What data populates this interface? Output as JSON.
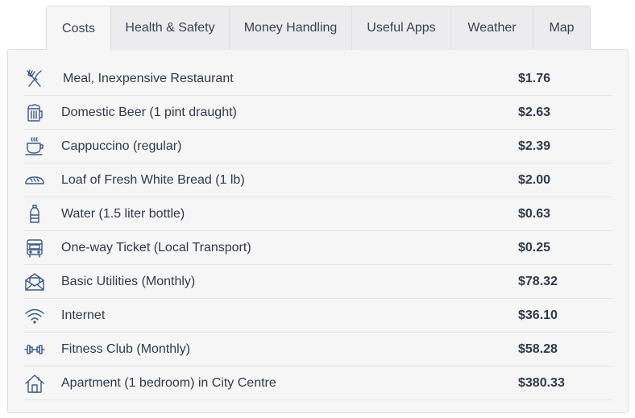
{
  "tabs": [
    {
      "label": "Costs",
      "active": true
    },
    {
      "label": "Health & Safety"
    },
    {
      "label": "Money Handling"
    },
    {
      "label": "Useful Apps"
    },
    {
      "label": "Weather"
    },
    {
      "label": "Map"
    }
  ],
  "costs": [
    {
      "icon": "fork-knife-icon",
      "label": "Meal, Inexpensive Restaurant",
      "value": "$1.76"
    },
    {
      "icon": "beer-mug-icon",
      "label": "Domestic Beer (1 pint draught)",
      "value": "$2.63"
    },
    {
      "icon": "coffee-cup-icon",
      "label": "Cappuccino (regular)",
      "value": "$2.39"
    },
    {
      "icon": "bread-icon",
      "label": "Loaf of Fresh White Bread (1 lb)",
      "value": "$2.00"
    },
    {
      "icon": "water-bottle-icon",
      "label": "Water (1.5 liter bottle)",
      "value": "$0.63"
    },
    {
      "icon": "bus-icon",
      "label": "One-way Ticket (Local Transport)",
      "value": "$0.25"
    },
    {
      "icon": "envelope-icon",
      "label": "Basic Utilities (Monthly)",
      "value": "$78.32"
    },
    {
      "icon": "wifi-icon",
      "label": "Internet",
      "value": "$36.10"
    },
    {
      "icon": "dumbbell-icon",
      "label": "Fitness Club (Monthly)",
      "value": "$58.28"
    },
    {
      "icon": "house-icon",
      "label": "Apartment (1 bedroom) in City Centre",
      "value": "$380.33"
    }
  ]
}
